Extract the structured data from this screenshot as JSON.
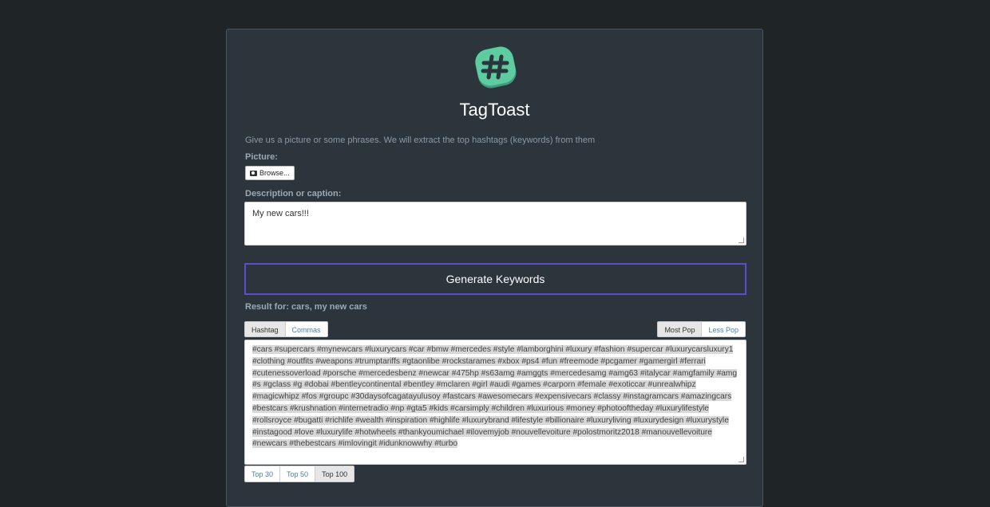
{
  "app": {
    "title": "TagToast",
    "intro": "Give us a picture or some phrases. We will extract the top hashtags (keywords) from them"
  },
  "picture": {
    "label": "Picture:",
    "browse_label": "Browse..."
  },
  "caption": {
    "label": "Description or caption:",
    "value": "My new cars!!!"
  },
  "generate_label": "Generate Keywords",
  "result": {
    "label": "Result for: cars, my new cars"
  },
  "format_tabs": [
    "Hashtag",
    "Commas"
  ],
  "popularity_tabs": [
    "Most Pop",
    "Less Pop"
  ],
  "top_tabs": [
    "Top 30",
    "Top 50",
    "Top 100"
  ],
  "hashtags_text": "#cars #supercars #mynewcars #luxurycars #car #bmw #mercedes #style #lamborghini #luxury #fashion #supercar #luxurycarsluxury1 #clothing #outfits #weapons #trumptariffs #gtaonlibe #rockstarames #xbox #ps4 #fun #freemode #pcgamer #gamergirl #ferrari #cutenessoverload #porsche #mercedesbenz #newcar #475hp #s63amg #amggts #mercedesamg #amg63 #italycar #amgfamily #amg #s #gclass #g #dobai #bentleycontinental #bentley #mclaren #girl #audi #games #carporn #female #exoticcar #unrealwhipz #magicwhipz #fos #groupc #30daysofcagatayulusoy #fastcars #awesomecars #expensivecars #classy #instagramcars #amazingcars #bestcars #krushnation #internetradio #np #gta5 #kids #carsimply #children #luxurious #money #photooftheday #luxurylifestyle #rollsroyce #bugatti #richlife #wealth #inspiration #highlife #luxurybrand #lifestyle #billionaire #luxuryliving #luxurydesign #luxurystyle #instagood #love #luxurylife #hotwheels #thankyoumichael #ilovemyjob #nouvellevoiture #polostmoritz2018 #manouvellevoiture #newcars #thebestcars #imlovingit #idunknowwhy #turbo",
  "colors": {
    "background": "#1f2427",
    "panel": "#2b353b",
    "accent_border": "#5a4fc9",
    "logo": "#5ecba1"
  },
  "icons": {
    "logo": "hashtag-logo-icon",
    "camera": "camera-icon"
  }
}
